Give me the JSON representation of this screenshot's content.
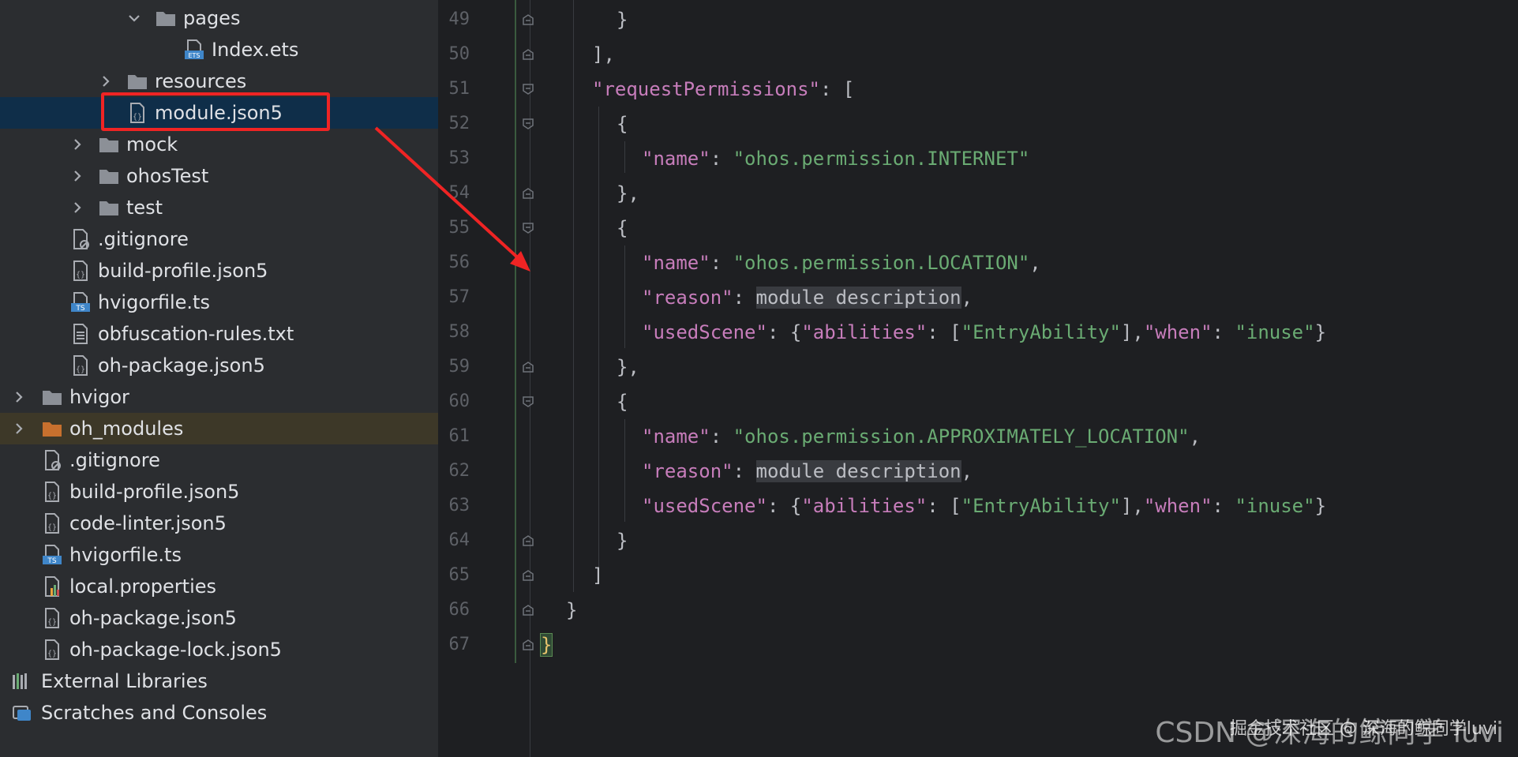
{
  "tree": {
    "items": [
      {
        "label": "pages",
        "kind": "folder",
        "expanded": true
      },
      {
        "label": "Index.ets",
        "kind": "ets"
      },
      {
        "label": "resources",
        "kind": "folder",
        "expanded": false
      },
      {
        "label": "module.json5",
        "kind": "json",
        "selected": true
      },
      {
        "label": "mock",
        "kind": "folder",
        "expanded": false
      },
      {
        "label": "ohosTest",
        "kind": "folder",
        "expanded": false
      },
      {
        "label": "test",
        "kind": "folder",
        "expanded": false
      },
      {
        "label": ".gitignore",
        "kind": "ignore"
      },
      {
        "label": "build-profile.json5",
        "kind": "json"
      },
      {
        "label": "hvigorfile.ts",
        "kind": "ts"
      },
      {
        "label": "obfuscation-rules.txt",
        "kind": "txt"
      },
      {
        "label": "oh-package.json5",
        "kind": "json"
      },
      {
        "label": "hvigor",
        "kind": "folder",
        "expanded": false
      },
      {
        "label": "oh_modules",
        "kind": "folder-orange",
        "expanded": false
      },
      {
        "label": ".gitignore",
        "kind": "ignore"
      },
      {
        "label": "build-profile.json5",
        "kind": "json"
      },
      {
        "label": "code-linter.json5",
        "kind": "json"
      },
      {
        "label": "hvigorfile.ts",
        "kind": "ts"
      },
      {
        "label": "local.properties",
        "kind": "props"
      },
      {
        "label": "oh-package.json5",
        "kind": "json"
      },
      {
        "label": "oh-package-lock.json5",
        "kind": "json"
      },
      {
        "label": "External Libraries",
        "kind": "libs"
      },
      {
        "label": "Scratches and Consoles",
        "kind": "scratch"
      }
    ]
  },
  "editor": {
    "line_numbers": [
      "49",
      "50",
      "51",
      "52",
      "53",
      "54",
      "55",
      "56",
      "57",
      "58",
      "59",
      "60",
      "61",
      "62",
      "63",
      "64",
      "65",
      "66",
      "67"
    ],
    "code": {
      "l49": "}",
      "l50": "],",
      "l51_key": "\"requestPermissions\"",
      "l51_rest": ": [",
      "l52": "{",
      "l53_key": "\"name\"",
      "l53_val": "\"ohos.permission.INTERNET\"",
      "l54": "},",
      "l55": "{",
      "l56_key": "\"name\"",
      "l56_val": "\"ohos.permission.LOCATION\"",
      "l57_key": "\"reason\"",
      "l57_val": "module description",
      "l58_key": "\"usedScene\"",
      "l58_k2": "\"abilities\"",
      "l58_v2": "\"EntryAbility\"",
      "l58_k3": "\"when\"",
      "l58_v3": "\"inuse\"",
      "l59": "},",
      "l60": "{",
      "l61_key": "\"name\"",
      "l61_val": "\"ohos.permission.APPROXIMATELY_LOCATION\"",
      "l62_key": "\"reason\"",
      "l62_val": "module description",
      "l63_key": "\"usedScene\"",
      "l63_k2": "\"abilities\"",
      "l63_v2": "\"EntryAbility\"",
      "l63_k3": "\"when\"",
      "l63_v3": "\"inuse\"",
      "l64": "}",
      "l65": "]",
      "l66": "}",
      "l67": "}"
    }
  },
  "watermark": "CSDN @深海的鲸同学 luvi",
  "watermark_top": "掘金技术社区 @ 深海的鲸同学luvi",
  "colors": {
    "annotation": "#ef2424",
    "key": "#c77dbb",
    "string": "#6aab73",
    "selection": "#0f2e49"
  }
}
